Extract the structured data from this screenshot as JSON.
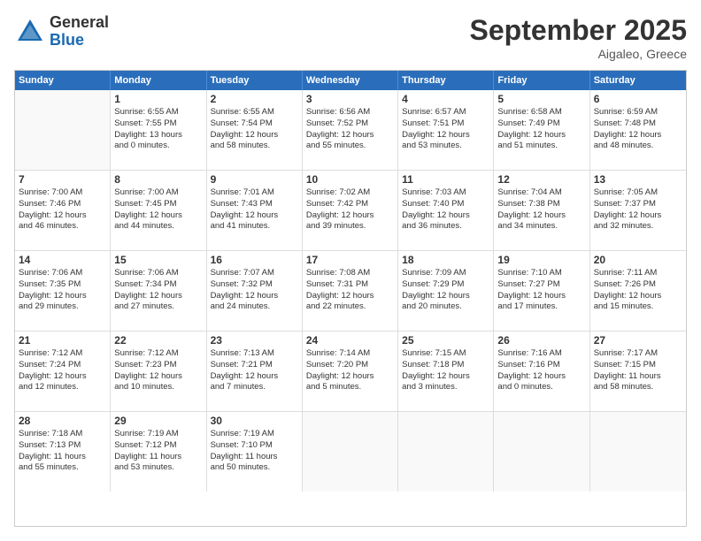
{
  "logo": {
    "general": "General",
    "blue": "Blue"
  },
  "title": "September 2025",
  "location": "Aigaleo, Greece",
  "header_days": [
    "Sunday",
    "Monday",
    "Tuesday",
    "Wednesday",
    "Thursday",
    "Friday",
    "Saturday"
  ],
  "weeks": [
    [
      {
        "day": "",
        "info": ""
      },
      {
        "day": "1",
        "info": "Sunrise: 6:55 AM\nSunset: 7:55 PM\nDaylight: 13 hours\nand 0 minutes."
      },
      {
        "day": "2",
        "info": "Sunrise: 6:55 AM\nSunset: 7:54 PM\nDaylight: 12 hours\nand 58 minutes."
      },
      {
        "day": "3",
        "info": "Sunrise: 6:56 AM\nSunset: 7:52 PM\nDaylight: 12 hours\nand 55 minutes."
      },
      {
        "day": "4",
        "info": "Sunrise: 6:57 AM\nSunset: 7:51 PM\nDaylight: 12 hours\nand 53 minutes."
      },
      {
        "day": "5",
        "info": "Sunrise: 6:58 AM\nSunset: 7:49 PM\nDaylight: 12 hours\nand 51 minutes."
      },
      {
        "day": "6",
        "info": "Sunrise: 6:59 AM\nSunset: 7:48 PM\nDaylight: 12 hours\nand 48 minutes."
      }
    ],
    [
      {
        "day": "7",
        "info": "Sunrise: 7:00 AM\nSunset: 7:46 PM\nDaylight: 12 hours\nand 46 minutes."
      },
      {
        "day": "8",
        "info": "Sunrise: 7:00 AM\nSunset: 7:45 PM\nDaylight: 12 hours\nand 44 minutes."
      },
      {
        "day": "9",
        "info": "Sunrise: 7:01 AM\nSunset: 7:43 PM\nDaylight: 12 hours\nand 41 minutes."
      },
      {
        "day": "10",
        "info": "Sunrise: 7:02 AM\nSunset: 7:42 PM\nDaylight: 12 hours\nand 39 minutes."
      },
      {
        "day": "11",
        "info": "Sunrise: 7:03 AM\nSunset: 7:40 PM\nDaylight: 12 hours\nand 36 minutes."
      },
      {
        "day": "12",
        "info": "Sunrise: 7:04 AM\nSunset: 7:38 PM\nDaylight: 12 hours\nand 34 minutes."
      },
      {
        "day": "13",
        "info": "Sunrise: 7:05 AM\nSunset: 7:37 PM\nDaylight: 12 hours\nand 32 minutes."
      }
    ],
    [
      {
        "day": "14",
        "info": "Sunrise: 7:06 AM\nSunset: 7:35 PM\nDaylight: 12 hours\nand 29 minutes."
      },
      {
        "day": "15",
        "info": "Sunrise: 7:06 AM\nSunset: 7:34 PM\nDaylight: 12 hours\nand 27 minutes."
      },
      {
        "day": "16",
        "info": "Sunrise: 7:07 AM\nSunset: 7:32 PM\nDaylight: 12 hours\nand 24 minutes."
      },
      {
        "day": "17",
        "info": "Sunrise: 7:08 AM\nSunset: 7:31 PM\nDaylight: 12 hours\nand 22 minutes."
      },
      {
        "day": "18",
        "info": "Sunrise: 7:09 AM\nSunset: 7:29 PM\nDaylight: 12 hours\nand 20 minutes."
      },
      {
        "day": "19",
        "info": "Sunrise: 7:10 AM\nSunset: 7:27 PM\nDaylight: 12 hours\nand 17 minutes."
      },
      {
        "day": "20",
        "info": "Sunrise: 7:11 AM\nSunset: 7:26 PM\nDaylight: 12 hours\nand 15 minutes."
      }
    ],
    [
      {
        "day": "21",
        "info": "Sunrise: 7:12 AM\nSunset: 7:24 PM\nDaylight: 12 hours\nand 12 minutes."
      },
      {
        "day": "22",
        "info": "Sunrise: 7:12 AM\nSunset: 7:23 PM\nDaylight: 12 hours\nand 10 minutes."
      },
      {
        "day": "23",
        "info": "Sunrise: 7:13 AM\nSunset: 7:21 PM\nDaylight: 12 hours\nand 7 minutes."
      },
      {
        "day": "24",
        "info": "Sunrise: 7:14 AM\nSunset: 7:20 PM\nDaylight: 12 hours\nand 5 minutes."
      },
      {
        "day": "25",
        "info": "Sunrise: 7:15 AM\nSunset: 7:18 PM\nDaylight: 12 hours\nand 3 minutes."
      },
      {
        "day": "26",
        "info": "Sunrise: 7:16 AM\nSunset: 7:16 PM\nDaylight: 12 hours\nand 0 minutes."
      },
      {
        "day": "27",
        "info": "Sunrise: 7:17 AM\nSunset: 7:15 PM\nDaylight: 11 hours\nand 58 minutes."
      }
    ],
    [
      {
        "day": "28",
        "info": "Sunrise: 7:18 AM\nSunset: 7:13 PM\nDaylight: 11 hours\nand 55 minutes."
      },
      {
        "day": "29",
        "info": "Sunrise: 7:19 AM\nSunset: 7:12 PM\nDaylight: 11 hours\nand 53 minutes."
      },
      {
        "day": "30",
        "info": "Sunrise: 7:19 AM\nSunset: 7:10 PM\nDaylight: 11 hours\nand 50 minutes."
      },
      {
        "day": "",
        "info": ""
      },
      {
        "day": "",
        "info": ""
      },
      {
        "day": "",
        "info": ""
      },
      {
        "day": "",
        "info": ""
      }
    ]
  ]
}
